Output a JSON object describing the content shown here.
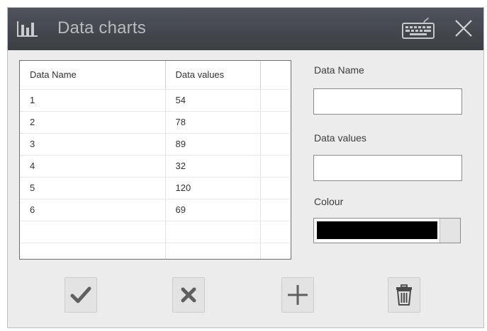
{
  "window": {
    "title": "Data charts",
    "icons": {
      "app": "bar-chart-icon",
      "keyboard": "keyboard-icon",
      "close": "close-icon"
    }
  },
  "table": {
    "columns": [
      "Data Name",
      "Data values"
    ],
    "rows": [
      {
        "name": "1",
        "value": "54"
      },
      {
        "name": "2",
        "value": "78"
      },
      {
        "name": "3",
        "value": "89"
      },
      {
        "name": "4",
        "value": "32"
      },
      {
        "name": "5",
        "value": "120"
      },
      {
        "name": "6",
        "value": "69"
      },
      {
        "name": "",
        "value": ""
      },
      {
        "name": "",
        "value": ""
      }
    ]
  },
  "form": {
    "name_label": "Data Name",
    "name_value": "",
    "values_label": "Data values",
    "values_value": "",
    "colour_label": "Colour",
    "colour_value": "#000000"
  },
  "actions": {
    "confirm_icon": "checkmark-icon",
    "cancel_icon": "x-icon",
    "add_icon": "plus-icon",
    "delete_icon": "trash-icon"
  }
}
